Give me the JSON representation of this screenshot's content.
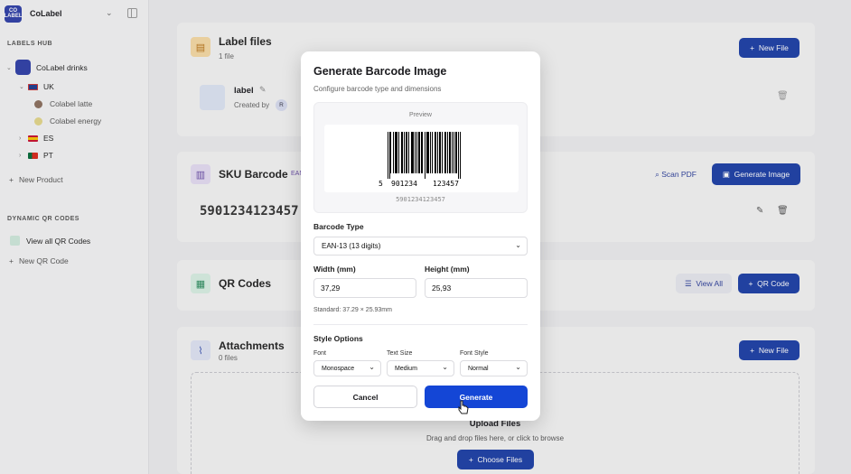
{
  "sidebar": {
    "app_name": "CoLabel",
    "logo_text": "CO LABEL",
    "labels_hub_title": "LABELS HUB",
    "company": "CoLabel drinks",
    "countries": [
      {
        "code": "UK",
        "products": [
          "Colabel latte",
          "Colabel energy"
        ]
      },
      {
        "code": "ES"
      },
      {
        "code": "PT"
      }
    ],
    "new_product": "New Product",
    "qr_section_title": "DYNAMIC QR CODES",
    "view_all_qr": "View all QR Codes",
    "new_qr": "New QR Code"
  },
  "main": {
    "label_files": {
      "title": "Label files",
      "count": "1 file",
      "new_button": "New File",
      "file": {
        "name": "label",
        "created_by": "Created by",
        "avatar": "R"
      }
    },
    "sku": {
      "title": "SKU Barcode",
      "badge": "EAN",
      "value": "5901234123457",
      "scan_button": "Scan PDF",
      "generate_button": "Generate Image"
    },
    "qr": {
      "title": "QR Codes",
      "view_all": "View All",
      "add_button": "QR Code"
    },
    "attachments": {
      "title": "Attachments",
      "count": "0 files",
      "new_button": "New File",
      "upload_title": "Upload Files",
      "upload_hint": "Drag and drop files here, or click to browse",
      "choose_button": "Choose Files"
    }
  },
  "dialog": {
    "title": "Generate Barcode Image",
    "subtitle": "Configure barcode type and dimensions",
    "preview_label": "Preview",
    "barcode_first_digit": "5",
    "barcode_left_digits": "901234",
    "barcode_right_digits": "123457",
    "barcode_caption": "5901234123457",
    "barcode_type_label": "Barcode Type",
    "barcode_type_value": "EAN-13 (13 digits)",
    "width_label": "Width (mm)",
    "width_value": "37,29",
    "height_label": "Height (mm)",
    "height_value": "25,93",
    "standard_hint": "Standard: 37.29 × 25.93mm",
    "style_title": "Style Options",
    "font_label": "Font",
    "font_value": "Monospace",
    "text_size_label": "Text Size",
    "text_size_value": "Medium",
    "font_style_label": "Font Style",
    "font_style_value": "Normal",
    "cancel": "Cancel",
    "generate": "Generate"
  },
  "colors": {
    "primary": "#1d3fa6",
    "generate": "#1446d6"
  }
}
